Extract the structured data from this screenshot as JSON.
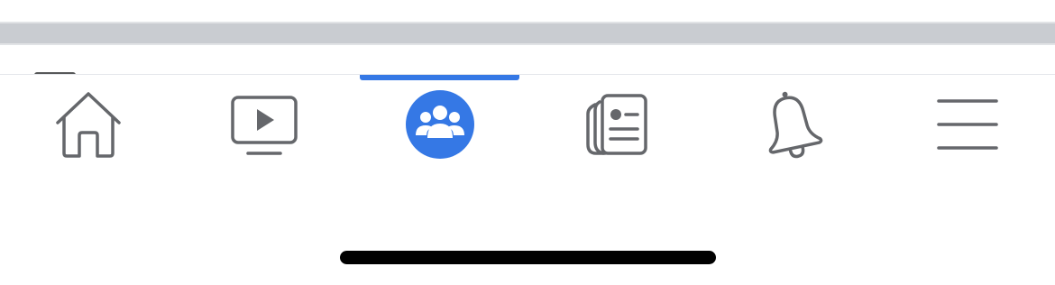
{
  "colors": {
    "accent": "#3578e5",
    "icon_inactive": "#65676b",
    "background": "#ffffff",
    "top_strip": "#c9ccd1",
    "home_indicator": "#000000"
  },
  "tabbar": {
    "active_index": 2,
    "tabs": [
      {
        "icon": "home-icon",
        "active": false
      },
      {
        "icon": "video-icon",
        "active": false
      },
      {
        "icon": "groups-icon",
        "active": true
      },
      {
        "icon": "news-feed-icon",
        "active": false
      },
      {
        "icon": "bell-icon",
        "active": false
      },
      {
        "icon": "menu-icon",
        "active": false
      }
    ]
  }
}
